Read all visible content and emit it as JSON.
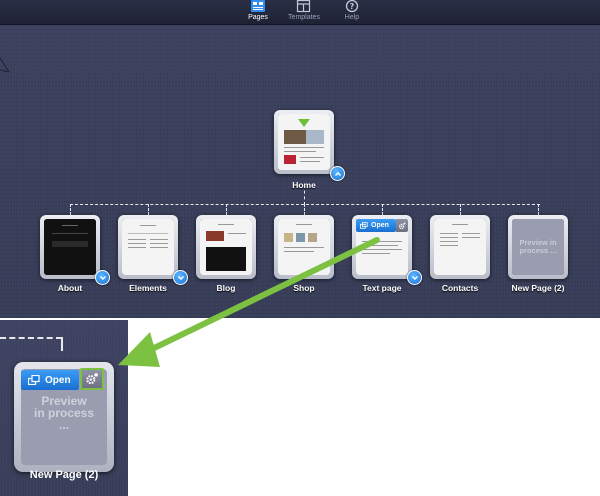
{
  "toolbar": {
    "pages_label": "Pages",
    "templates_label": "Templates",
    "help_label": "Help"
  },
  "home": {
    "label": "Home"
  },
  "pages": [
    {
      "label": "About"
    },
    {
      "label": "Elements"
    },
    {
      "label": "Blog"
    },
    {
      "label": "Shop"
    },
    {
      "label": "Text page",
      "open_label": "Open"
    },
    {
      "label": "Contacts"
    },
    {
      "label": "New Page (2)",
      "preview_text": "Preview in process ..."
    }
  ],
  "zoom": {
    "open_label": "Open",
    "preview_line1": "Preview",
    "preview_line2": "in process",
    "preview_line3": "...",
    "label": "New Page (2)"
  },
  "colors": {
    "canvas": "#3a3f5b",
    "accent_blue": "#1f7be0",
    "arrow_green": "#7dc142"
  }
}
